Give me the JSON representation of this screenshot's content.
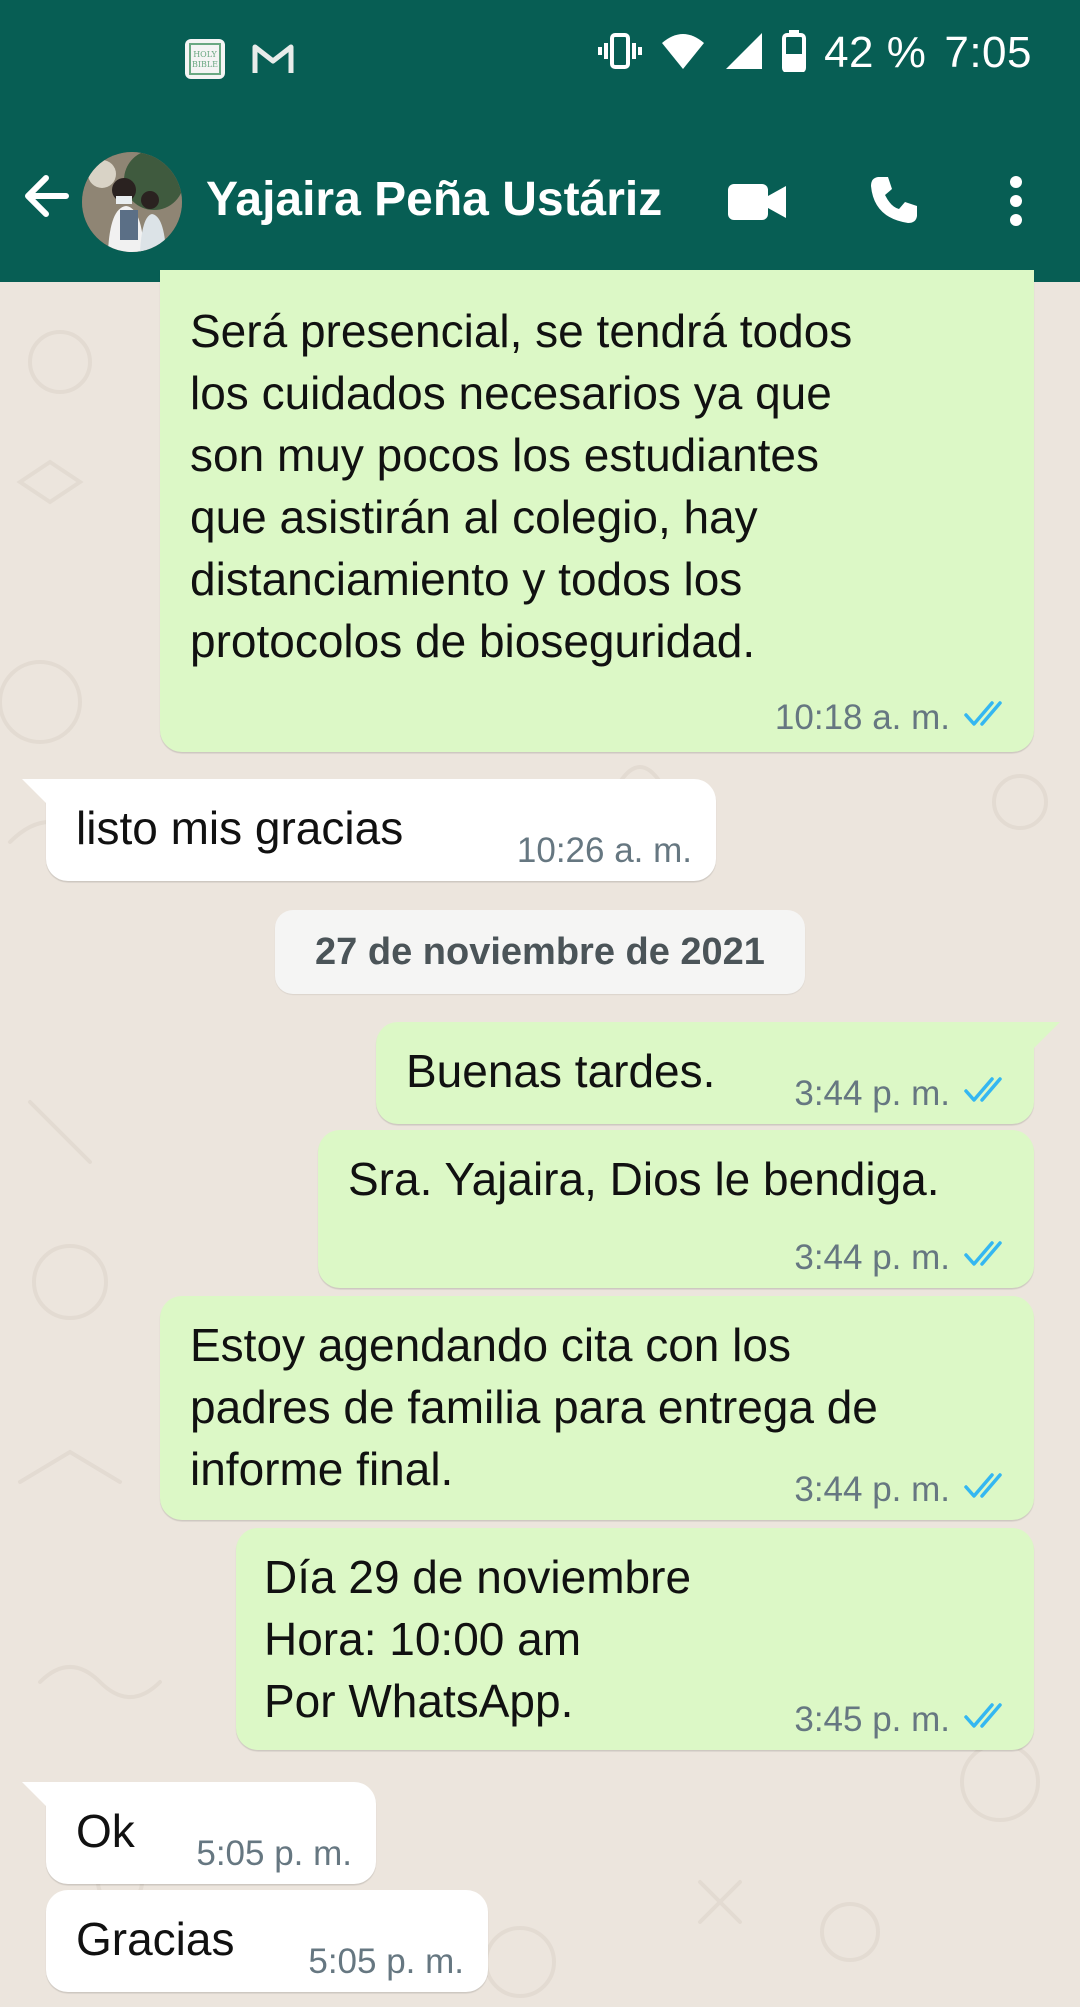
{
  "status_bar": {
    "battery": "42 %",
    "time": "7:05",
    "left_icons": [
      "holy-bible-app-icon",
      "gmail-icon"
    ],
    "right_icons": [
      "vibrate-icon",
      "wifi-icon",
      "signal-icon",
      "battery-icon"
    ]
  },
  "header": {
    "contact_name": "Yajaira Peña Ustáriz",
    "icons": [
      "back-arrow-icon",
      "video-call-icon",
      "voice-call-icon",
      "more-options-icon"
    ]
  },
  "colors": {
    "header": "#075e54",
    "outgoing_bubble": "#dcf8c6",
    "incoming_bubble": "#ffffff",
    "read_ticks": "#34b7f1",
    "background": "#ece5dd"
  },
  "messages": [
    {
      "direction": "out",
      "text": "Será presencial, se tendrá todos\nlos cuidados necesarios ya que\nson muy pocos los estudiantes\nque asistirán al colegio, hay\ndistanciamiento y todos los\nprotocolos de bioseguridad.",
      "time": "10:18 a. m.",
      "status": "read"
    },
    {
      "direction": "in",
      "text": "listo mis gracias",
      "time": "10:26 a. m."
    },
    {
      "direction": "out",
      "text": "Buenas tardes.",
      "time": "3:44 p. m.",
      "status": "read"
    },
    {
      "direction": "out",
      "text": "Sra. Yajaira, Dios le bendiga.",
      "time": "3:44 p. m.",
      "status": "read"
    },
    {
      "direction": "out",
      "text": "Estoy agendando cita con los\npadres de familia para entrega de\ninforme final.",
      "time": "3:44 p. m.",
      "status": "read"
    },
    {
      "direction": "out",
      "text": "Día 29 de noviembre\nHora: 10:00 am\nPor WhatsApp.",
      "time": "3:45 p. m.",
      "status": "read"
    },
    {
      "direction": "in",
      "text": "Ok",
      "time": "5:05 p. m."
    },
    {
      "direction": "in",
      "text": "Gracias",
      "time": "5:05 p. m."
    }
  ],
  "date_separator": "27 de noviembre de 2021"
}
